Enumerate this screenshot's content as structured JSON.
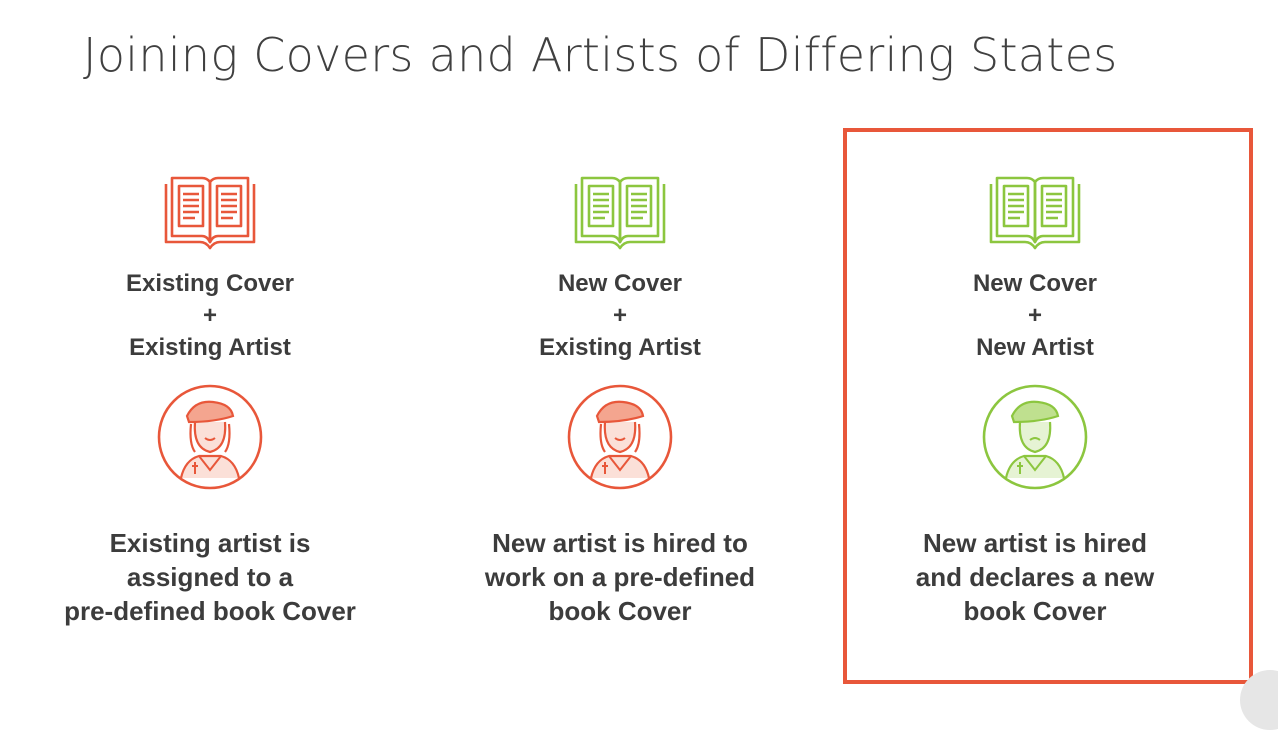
{
  "title": "Joining Covers and Artists of Differing States",
  "colors": {
    "existing": "#e8573a",
    "new": "#8cc63f",
    "text": "#3c3c3c",
    "highlight": "#e8573a"
  },
  "columns": [
    {
      "book_state": "existing",
      "artist_state": "existing",
      "cover_label": "Existing Cover",
      "plus": "+",
      "artist_label": "Existing Artist",
      "description": [
        "Existing artist is",
        "assigned to a",
        "pre-defined book Cover"
      ]
    },
    {
      "book_state": "new",
      "artist_state": "existing",
      "cover_label": "New Cover",
      "plus": "+",
      "artist_label": "Existing Artist",
      "description": [
        "New artist is hired to",
        "work on a pre-defined",
        "book Cover"
      ]
    },
    {
      "book_state": "new",
      "artist_state": "new",
      "cover_label": "New Cover",
      "plus": "+",
      "artist_label": "New Artist",
      "description": [
        "New artist is hired",
        "and declares a new",
        "book Cover"
      ],
      "highlighted": true
    }
  ]
}
